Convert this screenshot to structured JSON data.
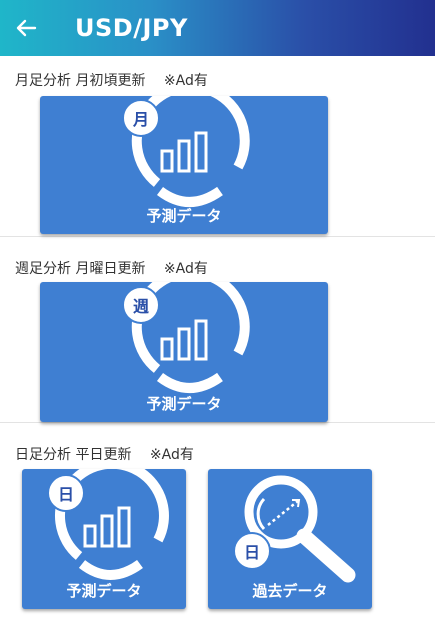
{
  "header": {
    "title": "USD/JPY",
    "back_icon": "arrow-left-icon"
  },
  "sections": [
    {
      "label": "月足分析 月初頃更新　 ※Ad有",
      "cards": [
        {
          "badge": "月",
          "label": "予測データ"
        }
      ]
    },
    {
      "label": "週足分析 月曜日更新　 ※Ad有",
      "cards": [
        {
          "badge": "週",
          "label": "予測データ"
        }
      ]
    },
    {
      "label": "日足分析 平日更新　 ※Ad有",
      "cards": [
        {
          "badge": "日",
          "label": "予測データ"
        },
        {
          "badge": "日",
          "label": "過去データ"
        }
      ]
    }
  ],
  "colors": {
    "card": "#3f7fd2",
    "badge_text": "#2a4fa8"
  }
}
